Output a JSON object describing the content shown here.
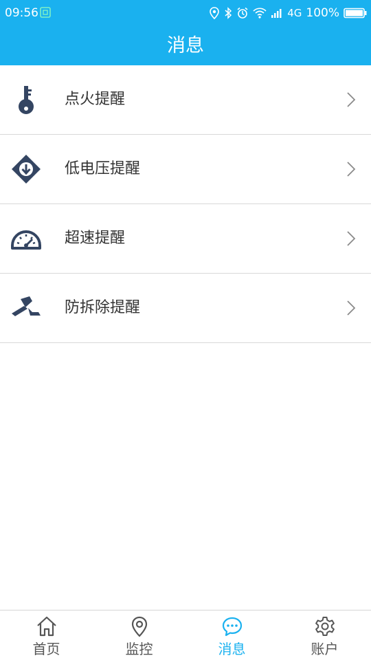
{
  "status_bar": {
    "time": "09:56",
    "network": "4G",
    "battery": "100%"
  },
  "header": {
    "title": "消息"
  },
  "messages": {
    "items": [
      {
        "label": "点火提醒",
        "icon": "key-icon"
      },
      {
        "label": "低电压提醒",
        "icon": "down-arrow-diamond-icon"
      },
      {
        "label": "超速提醒",
        "icon": "speedometer-icon"
      },
      {
        "label": "防拆除提醒",
        "icon": "hammer-icon"
      }
    ]
  },
  "tabs": [
    {
      "label": "首页",
      "icon": "home-icon",
      "active": false
    },
    {
      "label": "监控",
      "icon": "location-pin-icon",
      "active": false
    },
    {
      "label": "消息",
      "icon": "chat-bubble-icon",
      "active": true
    },
    {
      "label": "账户",
      "icon": "gear-icon",
      "active": false
    }
  ],
  "colors": {
    "accent": "#1ab1ef",
    "icon": "#344562",
    "divider": "#d8d8d8"
  }
}
